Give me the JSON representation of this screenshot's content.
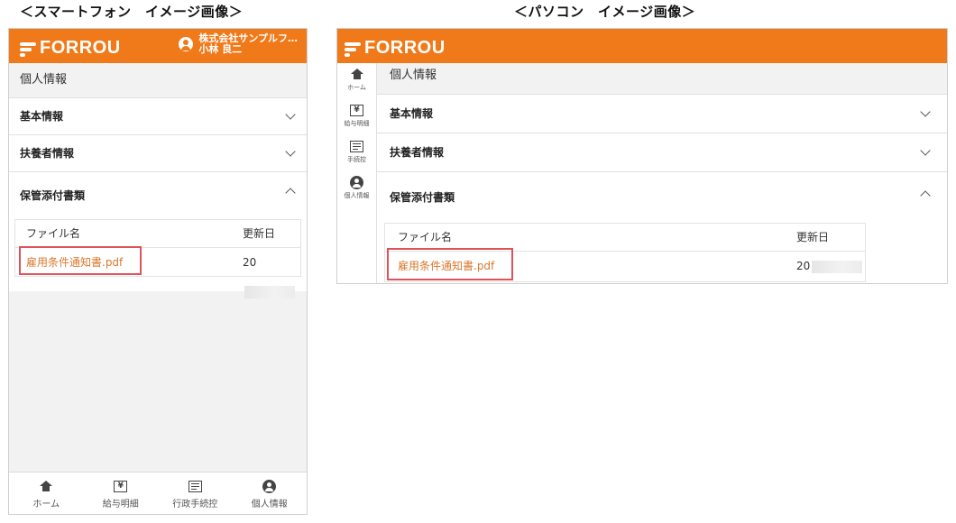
{
  "captions": {
    "smartphone": "＜スマートフォン　イメージ画像＞",
    "pc": "＜パソコン　イメージ画像＞"
  },
  "brand": {
    "name": "FORROU",
    "color": "#f07a1a"
  },
  "user": {
    "company": "株式会社サンプルフ…",
    "name": "小林 良二"
  },
  "page_title": "個人情報",
  "sections": [
    {
      "label": "基本情報",
      "state": "collapsed",
      "icon": "chevron-down-icon"
    },
    {
      "label": "扶養者情報",
      "state": "collapsed",
      "icon": "chevron-down-icon"
    },
    {
      "label": "保管添付書類",
      "state": "expanded",
      "icon": "chevron-up-icon"
    }
  ],
  "files_table": {
    "columns": [
      "ファイル名",
      "更新日"
    ],
    "rows": [
      {
        "file": "雇用条件通知書.pdf",
        "updated": "20"
      }
    ]
  },
  "nav": [
    {
      "label": "ホーム",
      "icon": "home-icon"
    },
    {
      "label": "給与明細",
      "icon": "yen-icon"
    },
    {
      "label": "行政手続控",
      "icon": "form-icon"
    },
    {
      "label": "個人情報",
      "icon": "person-icon"
    }
  ],
  "pc_nav": [
    {
      "label": "ホーム",
      "icon": "home-icon"
    },
    {
      "label": "給与明細",
      "icon": "yen-icon"
    },
    {
      "label": "手続控",
      "icon": "form-icon"
    },
    {
      "label": "個人情報",
      "icon": "person-icon"
    }
  ],
  "highlight_color": "#e0525a"
}
